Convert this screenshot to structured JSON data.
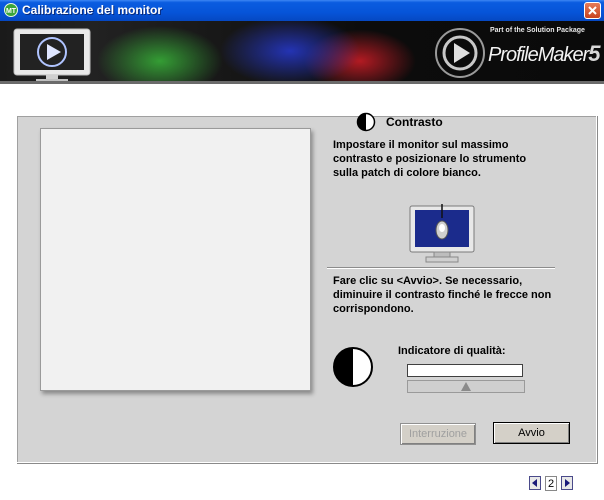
{
  "window": {
    "title": "Calibrazione del monitor",
    "title_icon": "mt-app-icon",
    "close_icon": "close-icon"
  },
  "banner": {
    "package_text": "Part of the Solution Package",
    "product_name": "ProfileMaker",
    "product_version": "5",
    "logo_icon": "monitor-play-icon"
  },
  "step": {
    "title": "Contrasto",
    "instruction_1": "Impostare il monitor sul massimo contrasto e posizionare lo strumento sulla patch di colore bianco.",
    "instruction_2": "Fare clic su <Avvio>. Se necessario, diminuire il contrasto finché le frecce non corrispondono.",
    "quality_label": "Indicatore di qualità:",
    "quality_pointer_position": 0.5,
    "patch_color": "#f1f1f1"
  },
  "buttons": {
    "stop_label": "Interruzione",
    "start_label": "Avvio"
  },
  "pager": {
    "page": "2",
    "prev_icon": "prev-page-icon",
    "next_icon": "next-page-icon"
  },
  "colors": {
    "titlebar": "#0654d8",
    "panel": "#d4d4d4",
    "monitor_screen": "#1b2b8c"
  }
}
